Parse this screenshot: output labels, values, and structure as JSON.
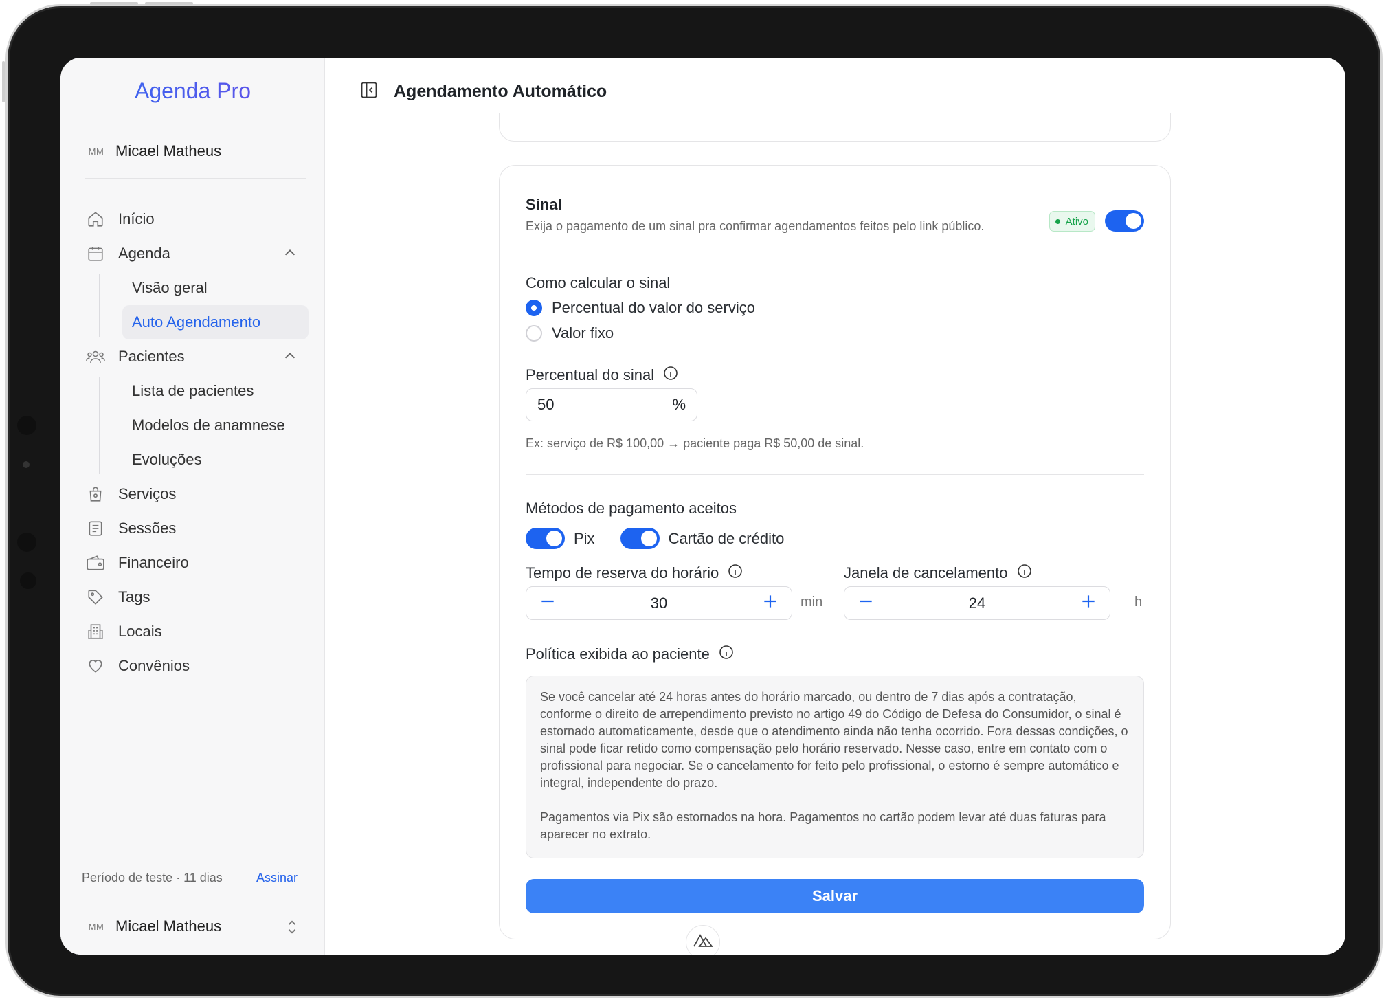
{
  "app": {
    "brand": "Agenda Pro",
    "user": {
      "initials": "MM",
      "name": "Micael Matheus"
    }
  },
  "sidebar": {
    "items": [
      {
        "label": "Início",
        "icon": "home-icon"
      },
      {
        "label": "Agenda",
        "icon": "calendar-icon",
        "expanded": true,
        "children": [
          {
            "label": "Visão geral"
          },
          {
            "label": "Auto Agendamento",
            "active": true
          }
        ]
      },
      {
        "label": "Pacientes",
        "icon": "users-icon",
        "expanded": true,
        "children": [
          {
            "label": "Lista de pacientes"
          },
          {
            "label": "Modelos de anamnese"
          },
          {
            "label": "Evoluções"
          }
        ]
      },
      {
        "label": "Serviços",
        "icon": "bag-icon"
      },
      {
        "label": "Sessões",
        "icon": "document-icon"
      },
      {
        "label": "Financeiro",
        "icon": "wallet-icon"
      },
      {
        "label": "Tags",
        "icon": "tag-icon"
      },
      {
        "label": "Locais",
        "icon": "building-icon"
      },
      {
        "label": "Convênios",
        "icon": "heart-icon"
      }
    ],
    "trial_text": "Período de teste · 11 dias",
    "subscribe_label": "Assinar"
  },
  "header": {
    "title": "Agendamento Automático"
  },
  "deposit": {
    "title": "Sinal",
    "description": "Exija o pagamento de um sinal pra confirmar agendamentos feitos pelo link público.",
    "status_badge": "Ativo",
    "enabled": true,
    "calc_label": "Como calcular o sinal",
    "calc_options": [
      {
        "label": "Percentual do valor do serviço",
        "selected": true
      },
      {
        "label": "Valor fixo",
        "selected": false
      }
    ],
    "percent_label": "Percentual do sinal",
    "percent_value": "50",
    "percent_unit": "%",
    "hint": "Ex: serviço de R$ 100,00 → paciente paga R$ 50,00 de sinal.",
    "methods_label": "Métodos de pagamento aceitos",
    "methods": [
      {
        "label": "Pix",
        "enabled": true
      },
      {
        "label": "Cartão de crédito",
        "enabled": true
      }
    ],
    "reserve": {
      "label": "Tempo de reserva do horário",
      "value": "30",
      "unit": "min"
    },
    "cancel_window": {
      "label": "Janela de cancelamento",
      "value": "24",
      "unit": "h"
    },
    "policy_label": "Política exibida ao paciente",
    "policy_paragraphs": [
      "Se você cancelar até 24 horas antes do horário marcado, ou dentro de 7 dias após a contratação, conforme o direito de arrependimento previsto no artigo 49 do Código de Defesa do Consumidor, o sinal é estornado automaticamente, desde que o atendimento ainda não tenha ocorrido. Fora dessas condições, o sinal pode ficar retido como compensação pelo horário reservado. Nesse caso, entre em contato com o profissional para negociar. Se o cancelamento for feito pelo profissional, o estorno é sempre automático e integral, independente do prazo.",
      "Pagamentos via Pix são estornados na hora. Pagamentos no cartão podem levar até duas faturas para aparecer no extrato."
    ],
    "save_label": "Salvar"
  },
  "colors": {
    "accent": "#1d63f0",
    "save_button": "#3b82f6",
    "active_badge": "#16a34a"
  }
}
